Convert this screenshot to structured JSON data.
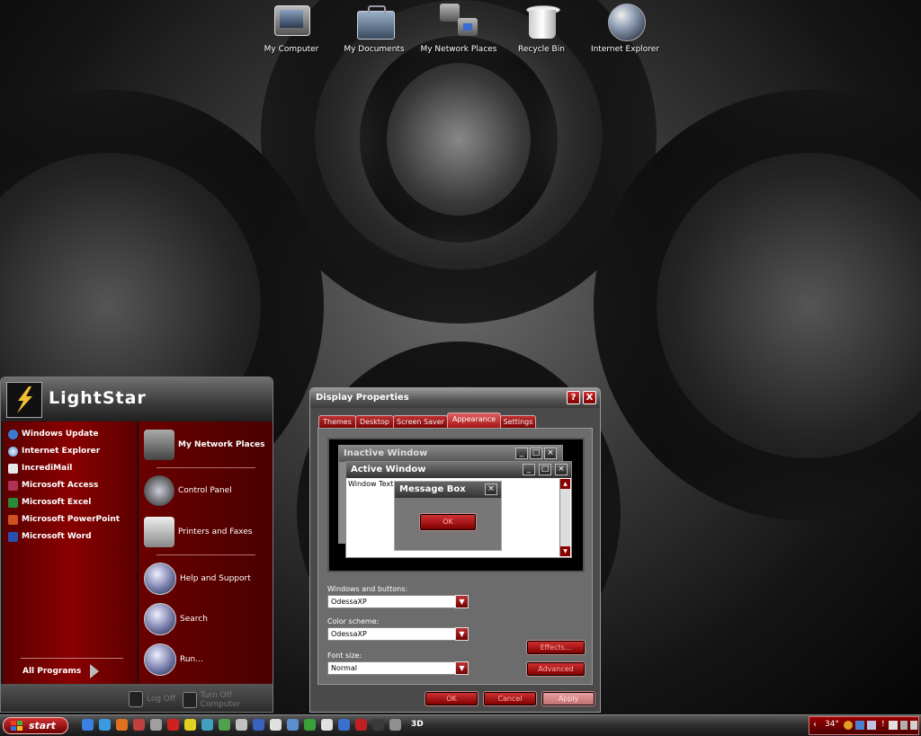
{
  "desktop_icons": [
    {
      "label": "My Computer",
      "icon": "my-computer-icon"
    },
    {
      "label": "My Documents",
      "icon": "my-documents-icon"
    },
    {
      "label": "My Network Places",
      "icon": "network-places-icon"
    },
    {
      "label": "Recycle Bin",
      "icon": "recycle-bin-icon"
    },
    {
      "label": "Internet Explorer",
      "icon": "internet-explorer-icon"
    }
  ],
  "start_menu": {
    "user": "LightStar",
    "left_items": [
      {
        "label": "Windows Update",
        "color": "#3a7ad0"
      },
      {
        "label": "Internet Explorer",
        "color": "#4a90e0"
      },
      {
        "label": "IncrediMail",
        "color": "#e8e8e8"
      },
      {
        "label": "Microsoft Access",
        "color": "#b0305a"
      },
      {
        "label": "Microsoft Excel",
        "color": "#2a8a3a"
      },
      {
        "label": "Microsoft PowerPoint",
        "color": "#d05020"
      },
      {
        "label": "Microsoft Word",
        "color": "#2a50b0"
      }
    ],
    "all_programs": "All Programs",
    "right_items": [
      {
        "label": "My Network Places",
        "icon": "network-places-icon"
      },
      {
        "label": "Control Panel",
        "icon": "control-panel-icon"
      },
      {
        "label": "Printers and Faxes",
        "icon": "printer-icon"
      },
      {
        "label": "Help and Support",
        "icon": "help-icon"
      },
      {
        "label": "Search",
        "icon": "search-icon"
      },
      {
        "label": "Run...",
        "icon": "run-icon"
      }
    ],
    "log_off": "Log Off",
    "turn_off": "Turn Off Computer"
  },
  "dialog": {
    "title": "Display Properties",
    "help_btn": "?",
    "close_btn": "X",
    "tabs": [
      "Themes",
      "Desktop",
      "Screen Saver",
      "Appearance",
      "Settings"
    ],
    "active_tab": "Appearance",
    "preview": {
      "inactive_title": "Inactive Window",
      "active_title": "Active Window",
      "window_text": "Window Text",
      "message_title": "Message Box",
      "ok": "OK"
    },
    "windows_buttons_label": "Windows and buttons:",
    "windows_buttons_value": "OdessaXP",
    "color_scheme_label": "Color scheme:",
    "color_scheme_value": "OdessaXP",
    "font_size_label": "Font size:",
    "font_size_value": "Normal",
    "effects": "Effects...",
    "advanced": "Advanced",
    "ok": "OK",
    "cancel": "Cancel",
    "apply": "Apply"
  },
  "taskbar": {
    "start": "start",
    "quick_launch_colors": [
      "#3a80e0",
      "#3a9ae0",
      "#e07020",
      "#c04040",
      "#a0a0a0",
      "#d02020",
      "#e0d020",
      "#40a0c0",
      "#50a050",
      "#c0c0c0",
      "#3a60c0",
      "#e0e0e0",
      "#5a90d0",
      "#3aa03a",
      "#e0e0e0",
      "#3a70d0",
      "#c02020",
      "#3a3a3a",
      "#909090"
    ],
    "tray_text": "34°",
    "tray_3d": "3D"
  }
}
